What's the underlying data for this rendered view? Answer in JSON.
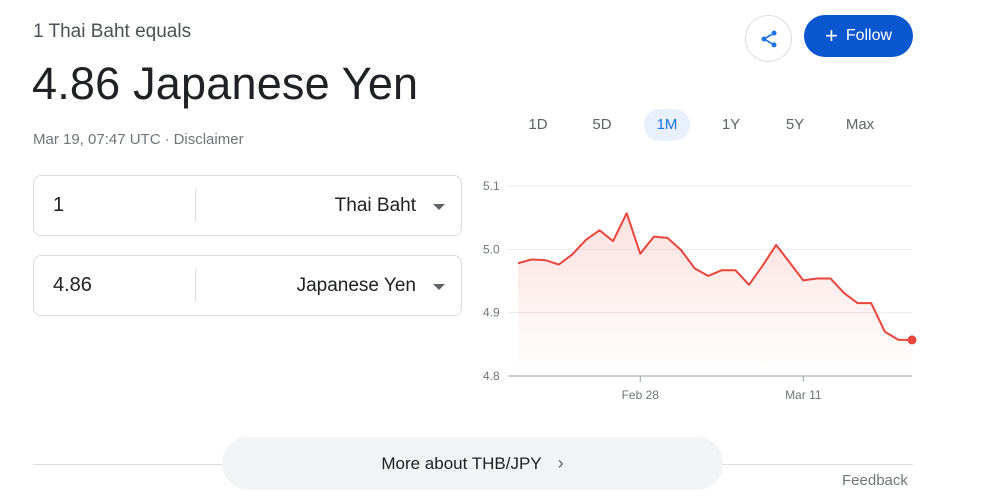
{
  "header": {
    "subtitle": "1 Thai Baht equals",
    "headline": "4.86 Japanese Yen",
    "timestamp": "Mar 19, 07:47 UTC",
    "separator": "·",
    "disclaimer": "Disclaimer"
  },
  "actions": {
    "share_icon": "share-icon",
    "follow_label": "Follow",
    "follow_icon": "+",
    "follow_color": "#0b57d0"
  },
  "converter": {
    "from": {
      "amount": "1",
      "currency": "Thai Baht"
    },
    "to": {
      "amount": "4.86",
      "currency": "Japanese Yen"
    }
  },
  "ranges": {
    "items": [
      "1D",
      "5D",
      "1M",
      "1Y",
      "5Y",
      "Max"
    ],
    "selected": "1M"
  },
  "chart_data": {
    "type": "line",
    "x": [
      "Feb 19",
      "Feb 20",
      "Feb 21",
      "Feb 22",
      "Feb 23",
      "Feb 24",
      "Feb 25",
      "Feb 26",
      "Feb 27",
      "Feb 28",
      "Feb 29",
      "Mar 1",
      "Mar 2",
      "Mar 3",
      "Mar 4",
      "Mar 5",
      "Mar 6",
      "Mar 7",
      "Mar 8",
      "Mar 9",
      "Mar 10",
      "Mar 11",
      "Mar 12",
      "Mar 13",
      "Mar 14",
      "Mar 15",
      "Mar 16",
      "Mar 17",
      "Mar 18",
      "Mar 19"
    ],
    "series": [
      {
        "values": [
          4.978,
          4.984,
          4.983,
          4.976,
          4.992,
          5.015,
          5.03,
          5.013,
          5.057,
          4.993,
          5.02,
          5.018,
          4.999,
          4.97,
          4.958,
          4.967,
          4.967,
          4.944,
          4.974,
          5.007,
          4.979,
          4.951,
          4.954,
          4.954,
          4.931,
          4.915,
          4.915,
          4.87,
          4.857,
          4.857
        ]
      }
    ],
    "ylim": [
      4.8,
      5.1
    ],
    "yticks": [
      "4.8",
      "4.9",
      "5.0",
      "5.1"
    ],
    "xticks": [
      {
        "label": "Feb 28",
        "index": 9
      },
      {
        "label": "Mar 11",
        "index": 21
      }
    ],
    "grid": true,
    "line_color": "#e8453c"
  },
  "footer": {
    "more_label": "More about THB/JPY",
    "more_icon": "chevron-right-icon",
    "feedback": "Feedback"
  }
}
